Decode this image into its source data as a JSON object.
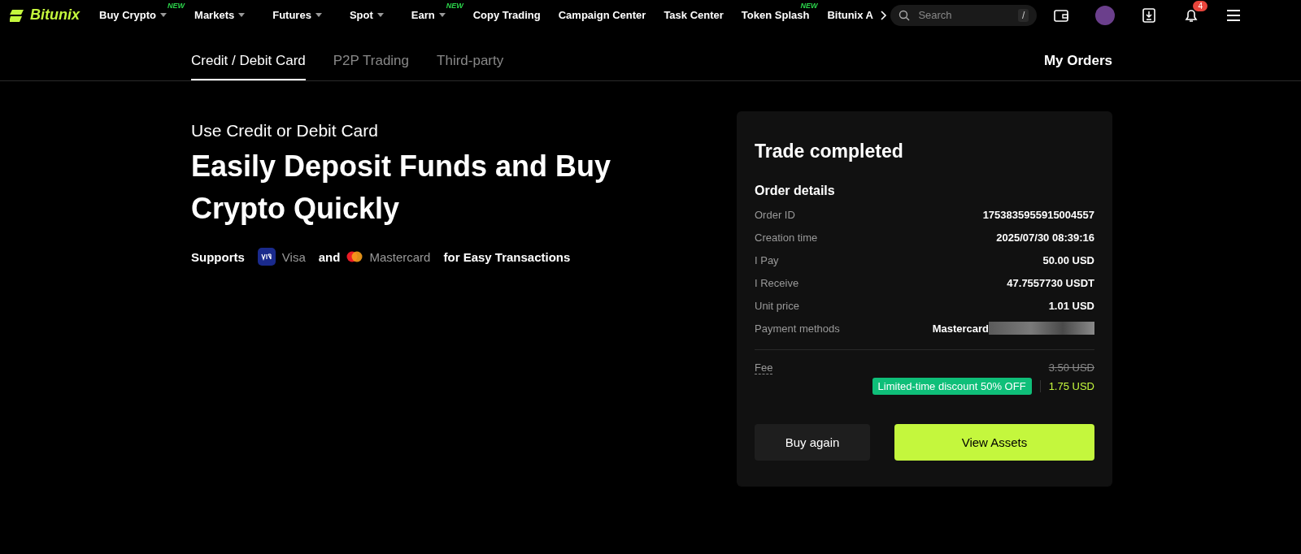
{
  "nav": {
    "logo": "Bitunix",
    "items": [
      {
        "label": "Buy Crypto",
        "dropdown": true,
        "badge": "NEW"
      },
      {
        "label": "Markets",
        "dropdown": true
      },
      {
        "label": "Futures",
        "dropdown": true
      },
      {
        "label": "Spot",
        "dropdown": true
      },
      {
        "label": "Earn",
        "dropdown": true,
        "badge": "NEW"
      },
      {
        "label": "Copy Trading",
        "dropdown": false
      },
      {
        "label": "Campaign Center",
        "dropdown": false
      },
      {
        "label": "Task Center",
        "dropdown": false
      },
      {
        "label": "Token Splash",
        "dropdown": false,
        "badge": "NEW"
      },
      {
        "label": "Bitunix A"
      }
    ],
    "search": {
      "placeholder": "Search",
      "shortcut": "/"
    },
    "notifications": "4"
  },
  "tabs": [
    {
      "label": "Credit / Debit Card",
      "selected": true
    },
    {
      "label": "P2P Trading",
      "selected": false
    },
    {
      "label": "Third-party",
      "selected": false
    }
  ],
  "my_orders": "My Orders",
  "hero": {
    "subtitle": "Use Credit or Debit Card",
    "title": "Easily Deposit Funds and Buy Crypto Quickly",
    "supports": [
      {
        "kind": "text",
        "text": "Supports"
      },
      {
        "kind": "visa",
        "text": "Visa"
      },
      {
        "kind": "text",
        "text": "and"
      },
      {
        "kind": "mastercard",
        "text": "Mastercard"
      },
      {
        "kind": "text",
        "text": "for Easy Transactions"
      }
    ]
  },
  "order": {
    "title": "Trade completed",
    "section": "Order details",
    "rows": [
      {
        "label": "Order ID",
        "value": "1753835955915004557"
      },
      {
        "label": "Creation time",
        "value": "2025/07/30 08:39:16"
      },
      {
        "label": "I Pay",
        "value": "50.00 USD"
      },
      {
        "label": "I Receive",
        "value": "47.7557730 USDT"
      },
      {
        "label": "Unit price",
        "value": "1.01 USD"
      },
      {
        "label": "Payment methods",
        "value": "Mastercard",
        "redacted": true
      }
    ],
    "fee": {
      "label": "Fee",
      "original": "3.50 USD",
      "discount": "Limited-time discount 50% OFF",
      "final": "1.75 USD"
    },
    "buttons": [
      {
        "label": "Buy again",
        "kind": "secondary"
      },
      {
        "label": "View Assets",
        "kind": "primary"
      }
    ]
  }
}
